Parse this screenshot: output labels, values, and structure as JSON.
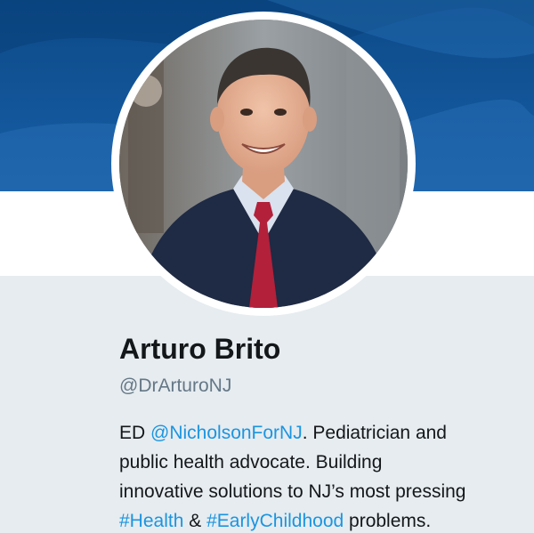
{
  "profile": {
    "name": "Arturo Brito",
    "handle": "@DrArturoNJ",
    "bio": {
      "line1_prefix": "ED ",
      "mention": "@NicholsonForNJ",
      "line1_suffix": ". Pediatrician and",
      "line2": "public health advocate. Building",
      "line3": "innovative solutions to NJ’s most pressing",
      "hashtag1": "#Health",
      "amp": " & ",
      "hashtag2": "#EarlyChildhood",
      "line4_suffix": " problems."
    }
  },
  "colors": {
    "banner": "#175ea6",
    "link": "#1b95e0",
    "background": "#e6ecf0",
    "text": "#14171a",
    "muted": "#657786"
  }
}
